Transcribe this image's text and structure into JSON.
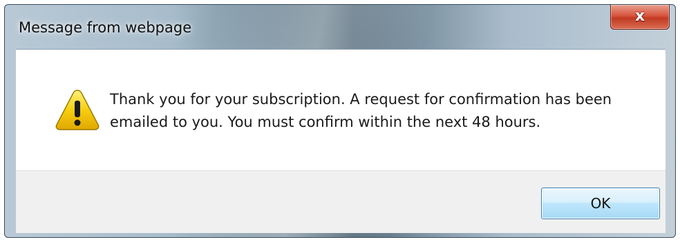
{
  "dialog": {
    "title": "Message from webpage",
    "close_icon_glyph": "x",
    "message_line_1": "Thank you for your subscription.  A request for confirmation has been",
    "message_line_2": "emailed to you.  You must confirm within the next 48 hours.",
    "icon": "warning-icon",
    "ok_label": "OK"
  },
  "colors": {
    "close_button": "#c13a22",
    "ok_button_border": "#3c7fb1",
    "footer_bg": "#f0f0f0",
    "warning_yellow": "#f5c400"
  }
}
